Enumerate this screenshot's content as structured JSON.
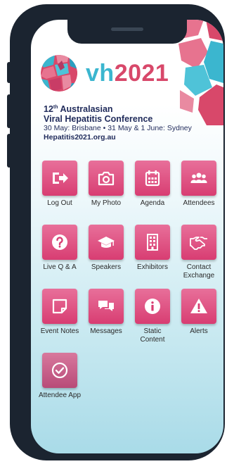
{
  "header": {
    "logo": {
      "prefix": "vh",
      "year": "2021"
    }
  },
  "conference": {
    "edition_num": "12",
    "edition_suffix": "th",
    "title_line1_rest": " Australasian",
    "title_line2": "Viral Hepatitis Conference",
    "dates": "30 May: Brisbane • 31 May & 1 June: Sydney",
    "website": "Hepatitis2021.org.au"
  },
  "tiles": [
    {
      "label": "Log Out",
      "icon": "logout-icon"
    },
    {
      "label": "My Photo",
      "icon": "camera-icon"
    },
    {
      "label": "Agenda",
      "icon": "calendar-icon"
    },
    {
      "label": "Attendees",
      "icon": "people-icon"
    },
    {
      "label": "Live Q & A",
      "icon": "question-icon"
    },
    {
      "label": "Speakers",
      "icon": "graduation-cap-icon"
    },
    {
      "label": "Exhibitors",
      "icon": "building-icon"
    },
    {
      "label": "Contact Exchange",
      "icon": "handshake-icon"
    },
    {
      "label": "Event Notes",
      "icon": "note-icon"
    },
    {
      "label": "Messages",
      "icon": "chat-icon"
    },
    {
      "label": "Static Content",
      "icon": "info-icon"
    },
    {
      "label": "Alerts",
      "icon": "warning-icon"
    },
    {
      "label": "Attendee App",
      "icon": "check-circle-icon"
    }
  ],
  "colors": {
    "tile": "#d83d72",
    "brand_teal": "#3bb6cf",
    "brand_pink": "#d8486a",
    "text_navy": "#1f2a5a"
  }
}
